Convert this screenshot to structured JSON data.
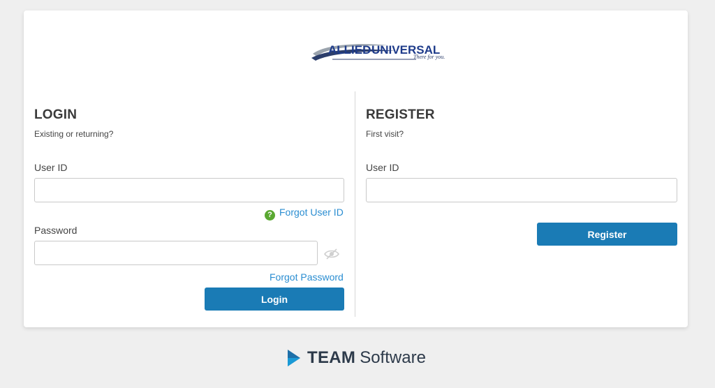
{
  "brand": {
    "logo_text_left": "ALLIED",
    "logo_text_right": "UNIVERSAL",
    "tagline": "There for you."
  },
  "login": {
    "title": "LOGIN",
    "subtitle": "Existing or returning?",
    "user_id_label": "User ID",
    "user_id_value": "",
    "forgot_user_id": "Forgot User ID",
    "password_label": "Password",
    "password_value": "",
    "forgot_password": "Forgot Password",
    "button_label": "Login"
  },
  "register": {
    "title": "REGISTER",
    "subtitle": "First visit?",
    "user_id_label": "User ID",
    "user_id_value": "",
    "button_label": "Register"
  },
  "footer": {
    "brand_bold": "TEAM",
    "brand_light": "Software"
  },
  "colors": {
    "accent": "#1a7bb5",
    "link": "#2a8dd1",
    "help": "#5aa831",
    "logo_navy": "#1e3b8a"
  }
}
